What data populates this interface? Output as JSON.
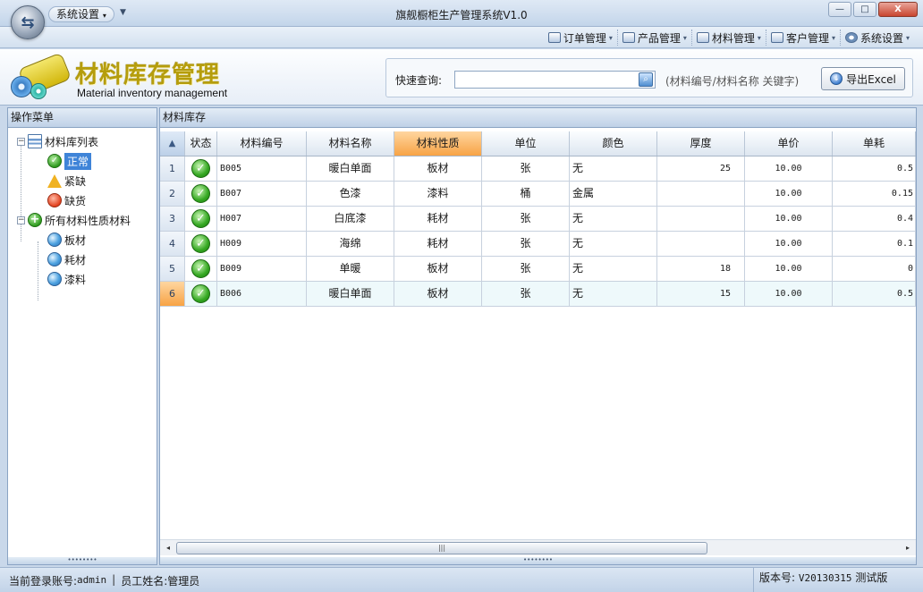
{
  "window": {
    "title": "旗舰橱柜生产管理系统V1.0",
    "system_menu_label": "系统设置",
    "minimize_glyph": "—",
    "maximize_glyph": "□",
    "close_glyph": "X"
  },
  "ribbon_menu": [
    {
      "label": "订单管理",
      "icon": "order-icon"
    },
    {
      "label": "产品管理",
      "icon": "product-icon"
    },
    {
      "label": "材料管理",
      "icon": "material-icon"
    },
    {
      "label": "客户管理",
      "icon": "customer-icon"
    },
    {
      "label": "系统设置",
      "icon": "gear-icon"
    }
  ],
  "header": {
    "title": "材料库存管理",
    "subtitle": "Material inventory management",
    "search_label": "快速查询:",
    "search_value": "",
    "search_hint": "(材料编号/材料名称 关键字)",
    "export_label": "导出Excel"
  },
  "left_panel": {
    "title": "操作菜单",
    "tree": {
      "group1": {
        "label": "材料库列表",
        "children": [
          "正常",
          "紧缺",
          "缺货"
        ]
      },
      "group2": {
        "label": "所有材料性质材料",
        "children": [
          "板材",
          "耗材",
          "漆料"
        ]
      }
    },
    "selected": "正常"
  },
  "right_panel": {
    "title": "材料库存",
    "columns": [
      "状态",
      "材料编号",
      "材料名称",
      "材料性质",
      "单位",
      "颜色",
      "厚度",
      "单价",
      "单耗"
    ],
    "sorted_column": "材料性质",
    "rows": [
      {
        "no": "1",
        "status": "ok",
        "code": "B005",
        "name": "暖白单面",
        "nature": "板材",
        "unit": "张",
        "color": "无",
        "thickness": "25",
        "price": "10.00",
        "consumption": "0.5"
      },
      {
        "no": "2",
        "status": "ok",
        "code": "B007",
        "name": "色漆",
        "nature": "漆料",
        "unit": "桶",
        "color": "金属",
        "thickness": "",
        "price": "10.00",
        "consumption": "0.15"
      },
      {
        "no": "3",
        "status": "ok",
        "code": "H007",
        "name": "白底漆",
        "nature": "耗材",
        "unit": "张",
        "color": "无",
        "thickness": "",
        "price": "10.00",
        "consumption": "0.4"
      },
      {
        "no": "4",
        "status": "ok",
        "code": "H009",
        "name": "海绵",
        "nature": "耗材",
        "unit": "张",
        "color": "无",
        "thickness": "",
        "price": "10.00",
        "consumption": "0.1"
      },
      {
        "no": "5",
        "status": "ok",
        "code": "B009",
        "name": "单暖",
        "nature": "板材",
        "unit": "张",
        "color": "无",
        "thickness": "18",
        "price": "10.00",
        "consumption": "0"
      },
      {
        "no": "6",
        "status": "ok",
        "code": "B006",
        "name": "暖白单面",
        "nature": "板材",
        "unit": "张",
        "color": "无",
        "thickness": "15",
        "price": "10.00",
        "consumption": "0.5"
      }
    ],
    "selected_row": "6",
    "scroll_thumb_glyph": "|||"
  },
  "statusbar": {
    "login_label": "当前登录账号:",
    "login_value": "admin",
    "separator": "|",
    "staff_label": "员工姓名:",
    "staff_value": "管理员",
    "version_label": "版本号:",
    "version_value": "V20130315",
    "version_note": "测试版"
  },
  "colors": {
    "accent": "#3f84d8",
    "title_gold": "#b59d0c",
    "sorted_header": "#f7a345",
    "ok_green": "#35a822"
  }
}
